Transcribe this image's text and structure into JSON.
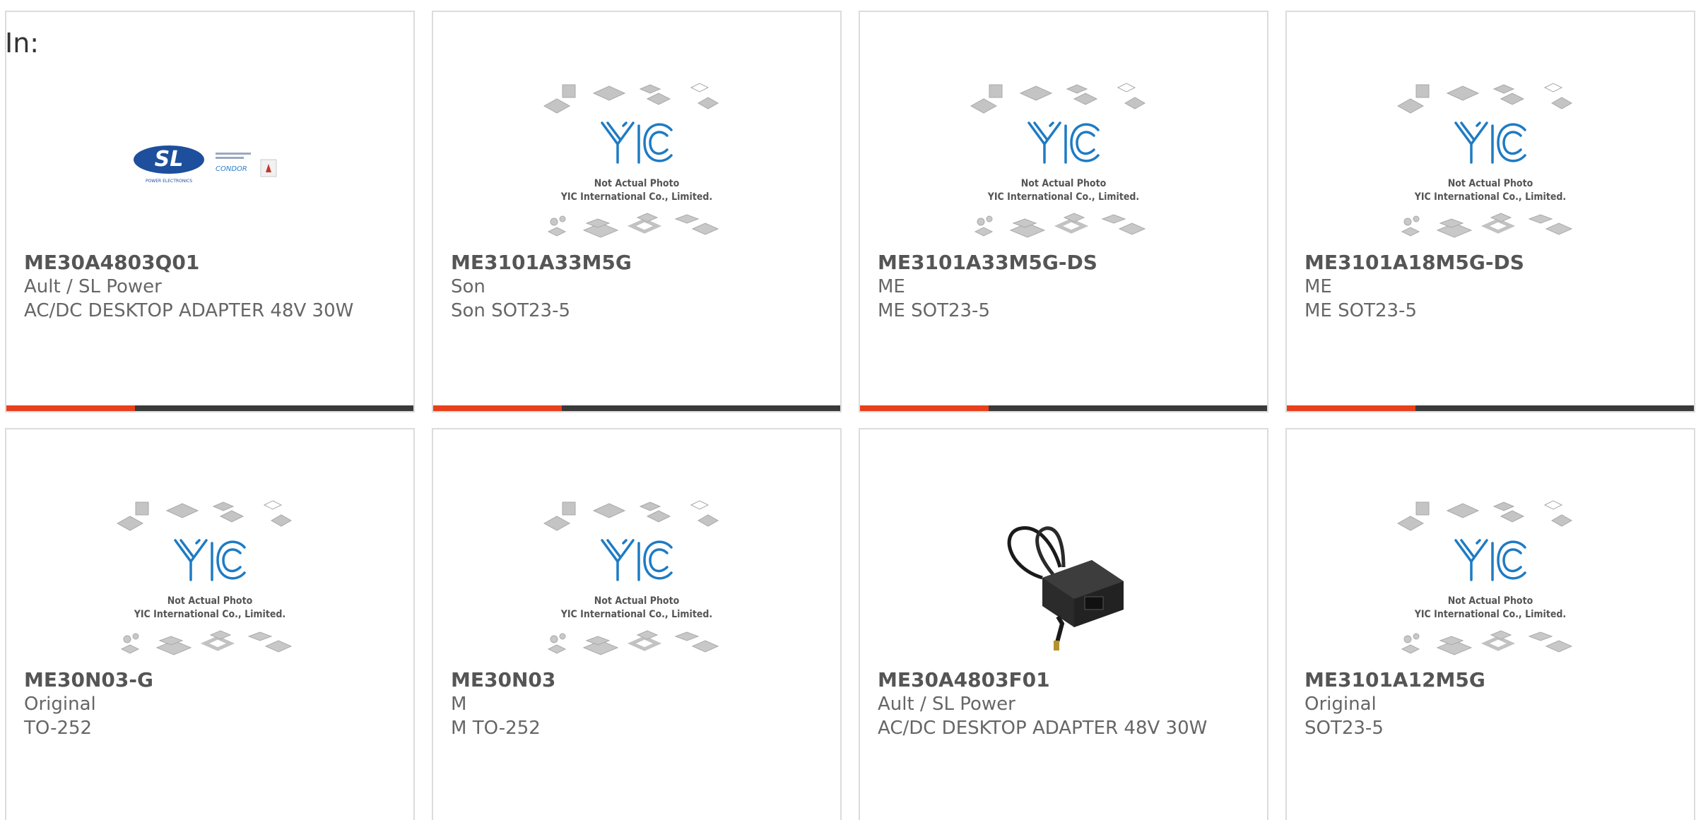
{
  "page": {
    "heading": "In:",
    "accent_color": "#e8401c",
    "bar_color": "#3a3a3a"
  },
  "placeholder_image": {
    "line1": "Not Actual Photo",
    "line2": "YIC International Co., Limited.",
    "logo": "YIC"
  },
  "sl_logo": {
    "text": "SL",
    "tagline": "POWER ELECTRONICS",
    "brand2": "CONDOR"
  },
  "products": [
    {
      "part": "ME30A4803Q01",
      "brand": "Ault / SL Power",
      "desc": "AC/DC DESKTOP ADAPTER 48V 30W",
      "image": "sl-power-logo"
    },
    {
      "part": "ME3101A33M5G",
      "brand": "Son",
      "desc": "Son SOT23-5",
      "image": "placeholder"
    },
    {
      "part": "ME3101A33M5G-DS",
      "brand": "ME",
      "desc": "ME SOT23-5",
      "image": "placeholder"
    },
    {
      "part": "ME3101A18M5G-DS",
      "brand": "ME",
      "desc": "ME SOT23-5",
      "image": "placeholder"
    },
    {
      "part": "ME30N03-G",
      "brand": "Original",
      "desc": "TO-252",
      "image": "placeholder"
    },
    {
      "part": "ME30N03",
      "brand": "M",
      "desc": "M TO-252",
      "image": "placeholder"
    },
    {
      "part": "ME30A4803F01",
      "brand": "Ault / SL Power",
      "desc": "AC/DC DESKTOP ADAPTER 48V 30W",
      "image": "power-adapter"
    },
    {
      "part": "ME3101A12M5G",
      "brand": "Original",
      "desc": "SOT23-5",
      "image": "placeholder"
    }
  ]
}
